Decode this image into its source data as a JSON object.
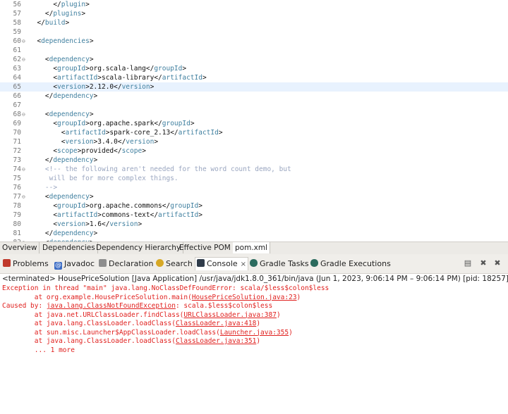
{
  "editor": {
    "lines": [
      {
        "n": "56",
        "fold": "",
        "parts": [
          {
            "c": "txt",
            "t": "      </"
          },
          {
            "c": "tag",
            "t": "plugin"
          },
          {
            "c": "txt",
            "t": ">"
          }
        ]
      },
      {
        "n": "57",
        "fold": "",
        "parts": [
          {
            "c": "txt",
            "t": "    </"
          },
          {
            "c": "tag",
            "t": "plugins"
          },
          {
            "c": "txt",
            "t": ">"
          }
        ]
      },
      {
        "n": "58",
        "fold": "",
        "parts": [
          {
            "c": "txt",
            "t": "  </"
          },
          {
            "c": "tag",
            "t": "build"
          },
          {
            "c": "txt",
            "t": ">"
          }
        ]
      },
      {
        "n": "59",
        "fold": "",
        "parts": []
      },
      {
        "n": "60",
        "fold": "⊖",
        "parts": [
          {
            "c": "txt",
            "t": "  <"
          },
          {
            "c": "tag",
            "t": "dependencies"
          },
          {
            "c": "txt",
            "t": ">"
          }
        ]
      },
      {
        "n": "61",
        "fold": "",
        "parts": []
      },
      {
        "n": "62",
        "fold": "⊖",
        "parts": [
          {
            "c": "txt",
            "t": "    <"
          },
          {
            "c": "tag",
            "t": "dependency"
          },
          {
            "c": "txt",
            "t": ">"
          }
        ]
      },
      {
        "n": "63",
        "fold": "",
        "parts": [
          {
            "c": "txt",
            "t": "      <"
          },
          {
            "c": "tag",
            "t": "groupId"
          },
          {
            "c": "txt",
            "t": ">org.scala-lang</"
          },
          {
            "c": "tag",
            "t": "groupId"
          },
          {
            "c": "txt",
            "t": ">"
          }
        ]
      },
      {
        "n": "64",
        "fold": "",
        "parts": [
          {
            "c": "txt",
            "t": "      <"
          },
          {
            "c": "tag",
            "t": "artifactId"
          },
          {
            "c": "txt",
            "t": ">scala-library</"
          },
          {
            "c": "tag",
            "t": "artifactId"
          },
          {
            "c": "txt",
            "t": ">"
          }
        ]
      },
      {
        "n": "65",
        "fold": "",
        "hl": true,
        "parts": [
          {
            "c": "txt",
            "t": "      <"
          },
          {
            "c": "tag",
            "t": "version"
          },
          {
            "c": "txt",
            "t": ">2.12.0</"
          },
          {
            "c": "tag",
            "t": "version"
          },
          {
            "c": "txt",
            "t": ">"
          }
        ]
      },
      {
        "n": "66",
        "fold": "",
        "parts": [
          {
            "c": "txt",
            "t": "    </"
          },
          {
            "c": "tag",
            "t": "dependency"
          },
          {
            "c": "txt",
            "t": ">"
          }
        ]
      },
      {
        "n": "67",
        "fold": "",
        "parts": []
      },
      {
        "n": "68",
        "fold": "⊖",
        "parts": [
          {
            "c": "txt",
            "t": "    <"
          },
          {
            "c": "tag",
            "t": "dependency"
          },
          {
            "c": "txt",
            "t": ">"
          }
        ]
      },
      {
        "n": "69",
        "fold": "",
        "parts": [
          {
            "c": "txt",
            "t": "      <"
          },
          {
            "c": "tag",
            "t": "groupId"
          },
          {
            "c": "txt",
            "t": ">org.apache.spark</"
          },
          {
            "c": "tag",
            "t": "groupId"
          },
          {
            "c": "txt",
            "t": ">"
          }
        ]
      },
      {
        "n": "70",
        "fold": "",
        "parts": [
          {
            "c": "txt",
            "t": "        <"
          },
          {
            "c": "tag",
            "t": "artifactId"
          },
          {
            "c": "txt",
            "t": ">spark-core_2.13</"
          },
          {
            "c": "tag",
            "t": "artifactId"
          },
          {
            "c": "txt",
            "t": ">"
          }
        ]
      },
      {
        "n": "71",
        "fold": "",
        "parts": [
          {
            "c": "txt",
            "t": "        <"
          },
          {
            "c": "tag",
            "t": "version"
          },
          {
            "c": "txt",
            "t": ">3.4.0</"
          },
          {
            "c": "tag",
            "t": "version"
          },
          {
            "c": "txt",
            "t": ">"
          }
        ]
      },
      {
        "n": "72",
        "fold": "",
        "parts": [
          {
            "c": "txt",
            "t": "      <"
          },
          {
            "c": "tag",
            "t": "scope"
          },
          {
            "c": "txt",
            "t": ">provided</"
          },
          {
            "c": "tag",
            "t": "scope"
          },
          {
            "c": "txt",
            "t": ">"
          }
        ]
      },
      {
        "n": "73",
        "fold": "",
        "parts": [
          {
            "c": "txt",
            "t": "    </"
          },
          {
            "c": "tag",
            "t": "dependency"
          },
          {
            "c": "txt",
            "t": ">"
          }
        ]
      },
      {
        "n": "74",
        "fold": "⊖",
        "parts": [
          {
            "c": "cmt",
            "t": "    <!-- the following aren't needed for the word count demo, but"
          }
        ]
      },
      {
        "n": "75",
        "fold": "",
        "parts": [
          {
            "c": "cmt",
            "t": "     will be for more complex things."
          }
        ]
      },
      {
        "n": "76",
        "fold": "",
        "parts": [
          {
            "c": "cmt",
            "t": "    -->"
          }
        ]
      },
      {
        "n": "77",
        "fold": "⊖",
        "parts": [
          {
            "c": "txt",
            "t": "    <"
          },
          {
            "c": "tag",
            "t": "dependency"
          },
          {
            "c": "txt",
            "t": ">"
          }
        ]
      },
      {
        "n": "78",
        "fold": "",
        "parts": [
          {
            "c": "txt",
            "t": "      <"
          },
          {
            "c": "tag",
            "t": "groupId"
          },
          {
            "c": "txt",
            "t": ">org.apache.commons</"
          },
          {
            "c": "tag",
            "t": "groupId"
          },
          {
            "c": "txt",
            "t": ">"
          }
        ]
      },
      {
        "n": "79",
        "fold": "",
        "parts": [
          {
            "c": "txt",
            "t": "      <"
          },
          {
            "c": "tag",
            "t": "artifactId"
          },
          {
            "c": "txt",
            "t": ">commons-text</"
          },
          {
            "c": "tag",
            "t": "artifactId"
          },
          {
            "c": "txt",
            "t": ">"
          }
        ]
      },
      {
        "n": "80",
        "fold": "",
        "parts": [
          {
            "c": "txt",
            "t": "      <"
          },
          {
            "c": "tag",
            "t": "version"
          },
          {
            "c": "txt",
            "t": ">1.6</"
          },
          {
            "c": "tag",
            "t": "version"
          },
          {
            "c": "txt",
            "t": ">"
          }
        ]
      },
      {
        "n": "81",
        "fold": "",
        "parts": [
          {
            "c": "txt",
            "t": "    </"
          },
          {
            "c": "tag",
            "t": "dependency"
          },
          {
            "c": "txt",
            "t": ">"
          }
        ]
      },
      {
        "n": "82",
        "fold": "⊖",
        "parts": [
          {
            "c": "txt",
            "t": "    <"
          },
          {
            "c": "tag",
            "t": "dependency"
          },
          {
            "c": "txt",
            "t": ">"
          }
        ]
      }
    ]
  },
  "editor_tabs": {
    "overview": "Overview",
    "dependencies": "Dependencies",
    "hierarchy": "Dependency Hierarchy",
    "effective_pom": "Effective POM",
    "pom_xml": "pom.xml"
  },
  "view_tabs": {
    "problems": "Problems",
    "javadoc": "Javadoc",
    "declaration": "Declaration",
    "search": "Search",
    "console": "Console",
    "close_symbol": "×",
    "gradle_tasks": "Gradle Tasks",
    "gradle_executions": "Gradle Executions"
  },
  "console": {
    "terminated": "<terminated> HousePriceSolution [Java Application] /usr/java/jdk1.8.0_361/bin/java  (Jun 1, 2023, 9:06:14 PM – 9:06:14 PM) [pid: 18257]",
    "lines": [
      {
        "parts": [
          {
            "t": "Exception in thread \"main\" java.lang.NoClassDefFoundError: scala/$less$colon$less",
            "l": false
          }
        ]
      },
      {
        "parts": [
          {
            "t": "        at org.example.HousePriceSolution.main(",
            "l": false
          },
          {
            "t": "HousePriceSolution.java:23",
            "l": true
          },
          {
            "t": ")",
            "l": false
          }
        ]
      },
      {
        "parts": [
          {
            "t": "Caused by: ",
            "l": false
          },
          {
            "t": "java.lang.ClassNotFoundException",
            "l": true
          },
          {
            "t": ": scala.$less$colon$less",
            "l": false
          }
        ]
      },
      {
        "parts": [
          {
            "t": "        at java.net.URLClassLoader.findClass(",
            "l": false
          },
          {
            "t": "URLClassLoader.java:387",
            "l": true
          },
          {
            "t": ")",
            "l": false
          }
        ]
      },
      {
        "parts": [
          {
            "t": "        at java.lang.ClassLoader.loadClass(",
            "l": false
          },
          {
            "t": "ClassLoader.java:418",
            "l": true
          },
          {
            "t": ")",
            "l": false
          }
        ]
      },
      {
        "parts": [
          {
            "t": "        at sun.misc.Launcher$AppClassLoader.loadClass(",
            "l": false
          },
          {
            "t": "Launcher.java:355",
            "l": true
          },
          {
            "t": ")",
            "l": false
          }
        ]
      },
      {
        "parts": [
          {
            "t": "        at java.lang.ClassLoader.loadClass(",
            "l": false
          },
          {
            "t": "ClassLoader.java:351",
            "l": true
          },
          {
            "t": ")",
            "l": false
          }
        ]
      },
      {
        "parts": [
          {
            "t": "        ... 1 more",
            "l": false
          }
        ]
      }
    ]
  },
  "colors": {
    "tag": "#3f7f9f",
    "comment": "#9aa6c0",
    "error": "#e0201e",
    "highlight": "#e8f2fe"
  },
  "icons": {
    "problems": "problems-icon",
    "javadoc": "javadoc-icon",
    "declaration": "declaration-icon",
    "search": "search-icon",
    "console": "console-icon",
    "gradle": "gradle-elephant-icon",
    "clear": "clear-console-icon",
    "remove": "remove-launch-icon",
    "remove_all": "remove-all-terminated-icon"
  }
}
